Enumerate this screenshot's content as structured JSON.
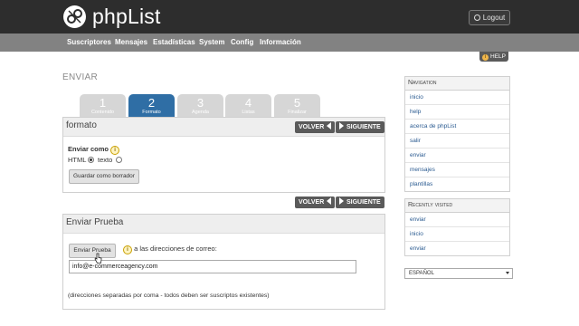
{
  "brand": {
    "logo_text": "phpList"
  },
  "header": {
    "logout_label": "Logout"
  },
  "nav": {
    "items": [
      "Suscriptores",
      "Mensajes",
      "Estadísticas",
      "System",
      "Config",
      "Información"
    ]
  },
  "help": {
    "label": "HELP"
  },
  "page": {
    "title": "ENVIAR"
  },
  "steps": [
    {
      "number": "1",
      "label": "Contenido",
      "active": false
    },
    {
      "number": "2",
      "label": "Formato",
      "active": true
    },
    {
      "number": "3",
      "label": "Agenda",
      "active": false
    },
    {
      "number": "4",
      "label": "Listas",
      "active": false
    },
    {
      "number": "5",
      "label": "Finalizar",
      "active": false
    }
  ],
  "format_panel": {
    "title": "formato",
    "back_label": "VOLVER",
    "next_label": "SIGUIENTE",
    "send_as_label": "Enviar como",
    "html_option": "HTML",
    "text_option": "texto",
    "selected": "HTML",
    "save_draft_label": "Guardar como borrador"
  },
  "mid_nav": {
    "back_label": "VOLVER",
    "next_label": "SIGUIENTE"
  },
  "test_panel": {
    "title": "Enviar Prueba",
    "send_test_label": "Enviar Prueba",
    "to_addresses_label": "a las direcciones de correo:",
    "email_value": "info@e-commerceagency.com",
    "hint": "(direcciones separadas por coma - todos deben ser suscriptos existentes)"
  },
  "sidebar": {
    "navigation_title": "Navigation",
    "navigation_items": [
      "inicio",
      "help",
      "acerca de phpList",
      "salir",
      "enviar",
      "mensajes",
      "plantillas"
    ],
    "recent_title": "Recently visited",
    "recent_items": [
      "enviar",
      "inicio",
      "enviar"
    ],
    "language_value": "ESPAÑOL"
  },
  "colors": {
    "topbar": "#2d2d2d",
    "navbar": "#828282",
    "active_step": "#2f6ea5",
    "inactive_step": "#d6d6d6",
    "nav_button": "#5a5a5a",
    "link": "#2a5a90"
  }
}
